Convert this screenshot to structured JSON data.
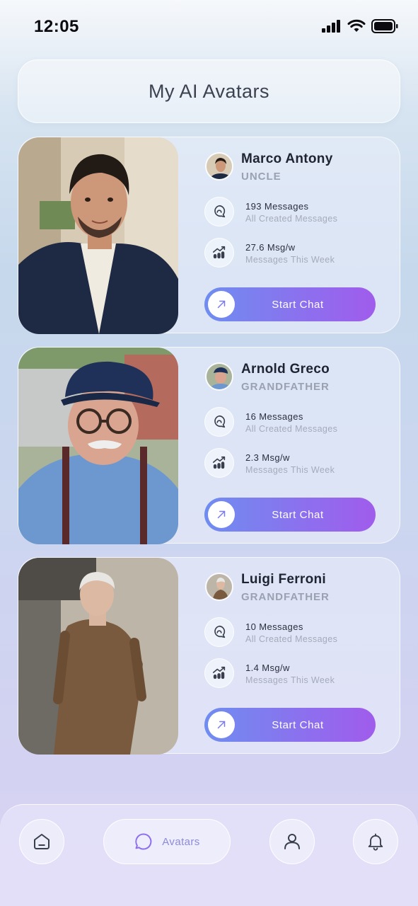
{
  "status_bar": {
    "time": "12:05"
  },
  "header": {
    "title": "My AI Avatars"
  },
  "avatars": [
    {
      "name": "Marco Antony",
      "relation": "UNCLE",
      "messages_value": "193 Messages",
      "messages_caption": "All Created Messages",
      "rate_value": "27.6 Msg/w",
      "rate_caption": "Messages This Week",
      "button_label": "Start Chat"
    },
    {
      "name": "Arnold Greco",
      "relation": "GRANDFATHER",
      "messages_value": "16 Messages",
      "messages_caption": "All Created Messages",
      "rate_value": "2.3 Msg/w",
      "rate_caption": "Messages This Week",
      "button_label": "Start Chat"
    },
    {
      "name": "Luigi Ferroni",
      "relation": "GRANDFATHER",
      "messages_value": "10 Messages",
      "messages_caption": "All Created Messages",
      "rate_value": "1.4 Msg/w",
      "rate_caption": "Messages This Week",
      "button_label": "Start Chat"
    }
  ],
  "bottom_nav": {
    "items": [
      {
        "icon": "home-icon"
      },
      {
        "icon": "chat-bubble-icon",
        "label": "Avatars",
        "active": true
      },
      {
        "icon": "profile-icon"
      },
      {
        "icon": "bell-icon"
      }
    ]
  },
  "colors": {
    "accent_start": "#6f8df0",
    "accent_end": "#a05cec",
    "nav_active": "#8d8bd8"
  }
}
